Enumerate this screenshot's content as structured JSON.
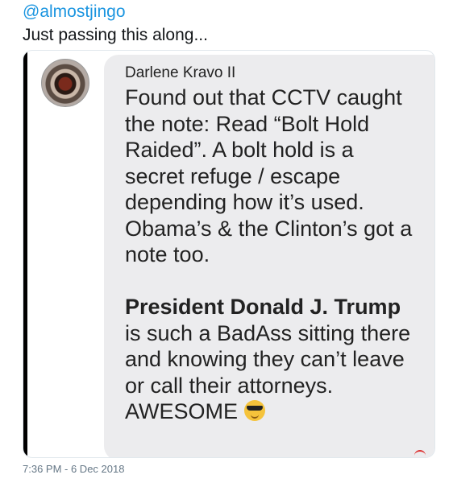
{
  "tweet": {
    "handle": "@almostjingo",
    "text": "Just passing this along...",
    "timestamp": "7:36 PM - 6 Dec 2018"
  },
  "embedded_post": {
    "author": "Darlene Kravo II",
    "paragraph1_lines": [
      "Found out that CCTV caught",
      "the note:   Read “Bolt Hold",
      "Raided”. A bolt hold is a",
      "secret refuge / escape",
      "depending how it’s used.",
      "Obama’s & the Clinton’s got a",
      "note too."
    ],
    "bold_name": "President Donald J. Trump",
    "paragraph2_lines": [
      "is such a BadAss sitting there",
      "and knowing they can’t leave",
      "or call their attorneys."
    ],
    "last_line": "AWESOME",
    "emoji": "smiling-face-with-sunglasses-icon"
  },
  "colors": {
    "handle": "#1b95e0",
    "bubble": "#ececee",
    "timestamp": "#657786"
  }
}
